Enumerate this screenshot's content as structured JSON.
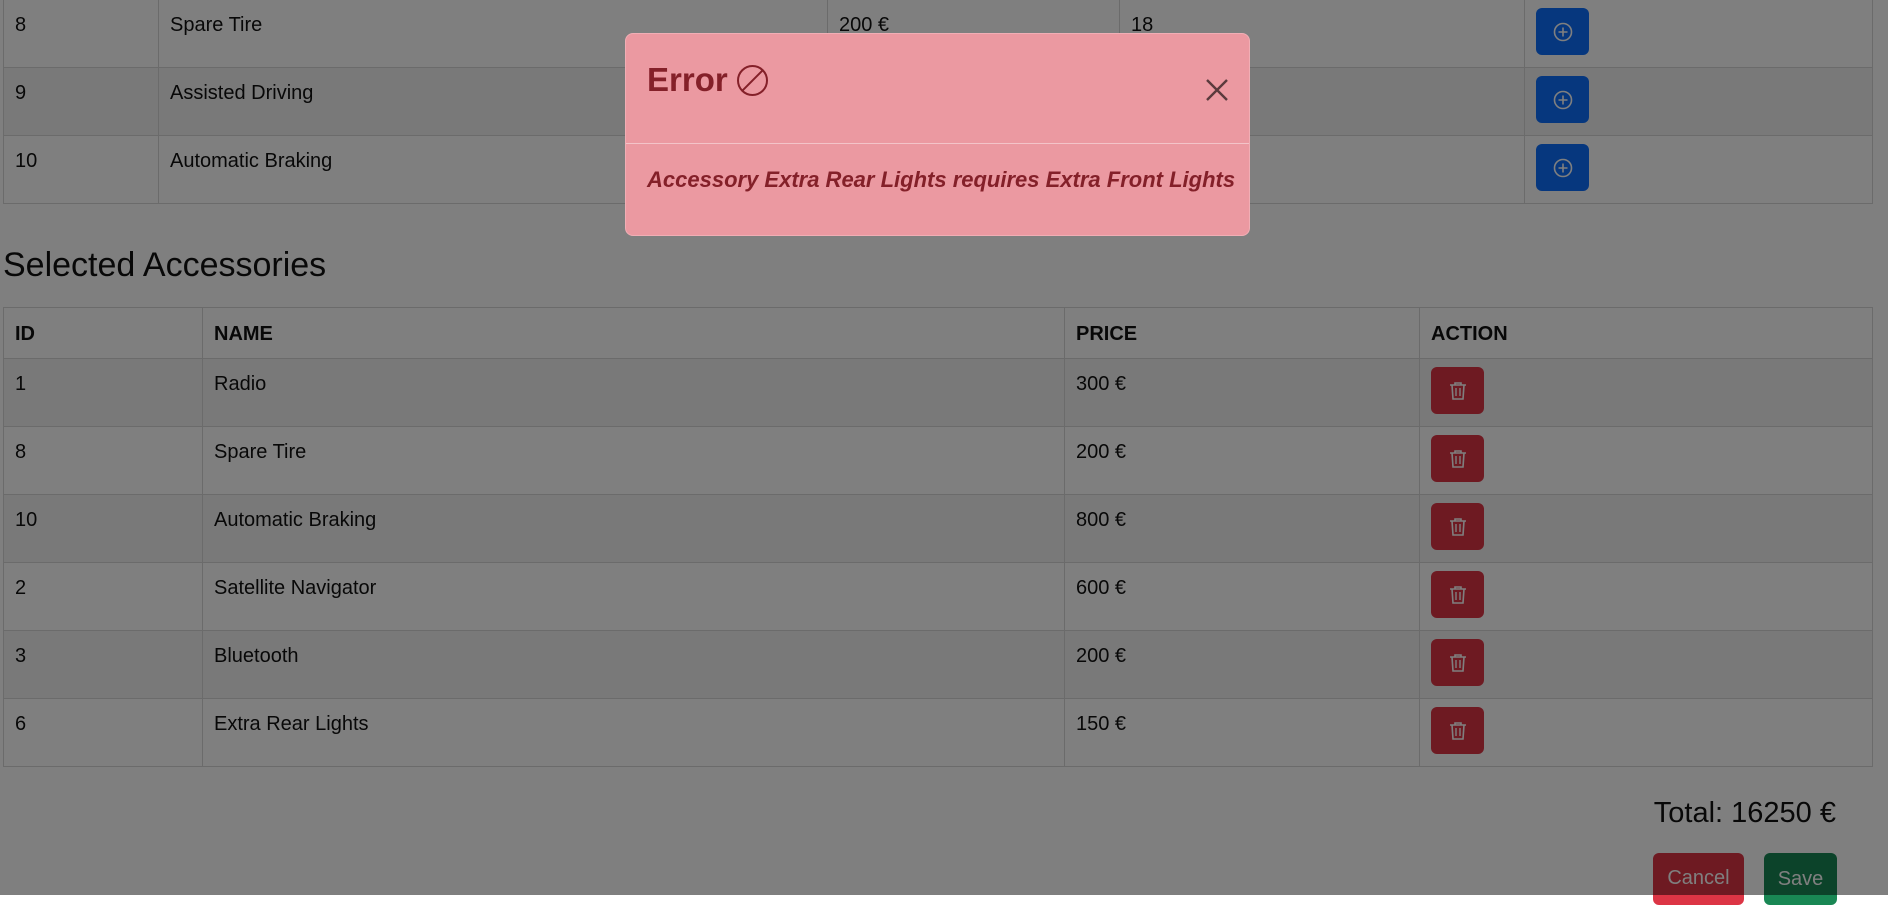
{
  "available": {
    "rows": [
      {
        "id": "8",
        "name": "Spare Tire",
        "price": "200 €",
        "qty": "18"
      },
      {
        "id": "9",
        "name": "Assisted Driving",
        "price": "",
        "qty": ""
      },
      {
        "id": "10",
        "name": "Automatic Braking",
        "price": "",
        "qty": ""
      }
    ],
    "add_icon": "plus-circle-icon"
  },
  "selected": {
    "title": "Selected Accessories",
    "headers": {
      "id": "ID",
      "name": "NAME",
      "price": "PRICE",
      "action": "ACTION"
    },
    "rows": [
      {
        "id": "1",
        "name": "Radio",
        "price": "300 €"
      },
      {
        "id": "8",
        "name": "Spare Tire",
        "price": "200 €"
      },
      {
        "id": "10",
        "name": "Automatic Braking",
        "price": "800 €"
      },
      {
        "id": "2",
        "name": "Satellite Navigator",
        "price": "600 €"
      },
      {
        "id": "3",
        "name": "Bluetooth",
        "price": "200 €"
      },
      {
        "id": "6",
        "name": "Extra Rear Lights",
        "price": "150 €"
      }
    ],
    "delete_icon": "trash-icon"
  },
  "footer": {
    "total": "Total: 16250 €",
    "cancel_label": "Cancel",
    "save_label": "Save"
  },
  "modal": {
    "title": "Error",
    "title_icon": "ban-icon",
    "message": "Accessory Extra Rear Lights requires Extra Front Lights",
    "close_icon": "close-icon"
  },
  "colors": {
    "primary": "#0d6efd",
    "danger": "#dc3545",
    "success": "#198754",
    "modal_bg": "#eb99a1",
    "modal_text": "#842029"
  }
}
